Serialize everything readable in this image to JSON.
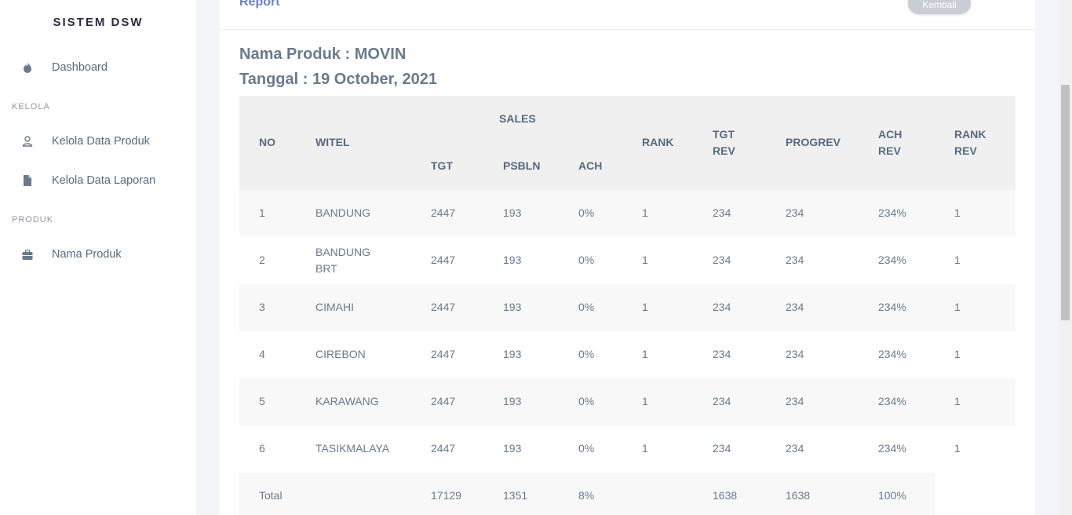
{
  "sidebar": {
    "brand": "SISTEM DSW",
    "items": [
      {
        "label": "Dashboard",
        "icon": "fire-icon"
      },
      {
        "label": "Kelola Data Produk",
        "icon": "user-icon"
      },
      {
        "label": "Kelola Data Laporan",
        "icon": "file-icon"
      },
      {
        "label": "Nama Produk",
        "icon": "briefcase-icon"
      }
    ],
    "sections": [
      "KELOLA",
      "PRODUK"
    ]
  },
  "header": {
    "report_link": "Report",
    "back_button": "Kembali"
  },
  "main": {
    "product_title": "Nama Produk : MOVIN",
    "date_title": "Tanggal : 19 October, 2021"
  },
  "table": {
    "headers": {
      "no": "NO",
      "witel": "WITEL",
      "sales": "SALES",
      "tgt": "TGT",
      "psbln": "PSBLN",
      "ach": "ACH",
      "rank": "RANK",
      "tgt_rev_1": "TGT",
      "tgt_rev_2": "REV",
      "progrev": "PROGREV",
      "ach_rev_1": "ACH",
      "ach_rev_2": "REV",
      "rank_rev_1": "RANK",
      "rank_rev_2": "REV"
    },
    "rows": [
      {
        "no": "1",
        "witel": "BANDUNG",
        "witel2": "",
        "tgt": "2447",
        "psbln": "193",
        "ach": "0%",
        "rank": "1",
        "tgt_rev": "234",
        "progrev": "234",
        "ach_rev": "234%",
        "rank_rev": "1"
      },
      {
        "no": "2",
        "witel": "BANDUNG",
        "witel2": "BRT",
        "tgt": "2447",
        "psbln": "193",
        "ach": "0%",
        "rank": "1",
        "tgt_rev": "234",
        "progrev": "234",
        "ach_rev": "234%",
        "rank_rev": "1"
      },
      {
        "no": "3",
        "witel": "CIMAHI",
        "witel2": "",
        "tgt": "2447",
        "psbln": "193",
        "ach": "0%",
        "rank": "1",
        "tgt_rev": "234",
        "progrev": "234",
        "ach_rev": "234%",
        "rank_rev": "1"
      },
      {
        "no": "4",
        "witel": "CIREBON",
        "witel2": "",
        "tgt": "2447",
        "psbln": "193",
        "ach": "0%",
        "rank": "1",
        "tgt_rev": "234",
        "progrev": "234",
        "ach_rev": "234%",
        "rank_rev": "1"
      },
      {
        "no": "5",
        "witel": "KARAWANG",
        "witel2": "",
        "tgt": "2447",
        "psbln": "193",
        "ach": "0%",
        "rank": "1",
        "tgt_rev": "234",
        "progrev": "234",
        "ach_rev": "234%",
        "rank_rev": "1"
      },
      {
        "no": "6",
        "witel": "TASIKMALAYA",
        "witel2": "",
        "tgt": "2447",
        "psbln": "193",
        "ach": "0%",
        "rank": "1",
        "tgt_rev": "234",
        "progrev": "234",
        "ach_rev": "234%",
        "rank_rev": "1"
      }
    ],
    "total": {
      "label": "Total",
      "tgt": "17129",
      "psbln": "1351",
      "ach": "8%",
      "tgt_rev": "1638",
      "progrev": "1638",
      "ach_rev": "100%"
    }
  }
}
